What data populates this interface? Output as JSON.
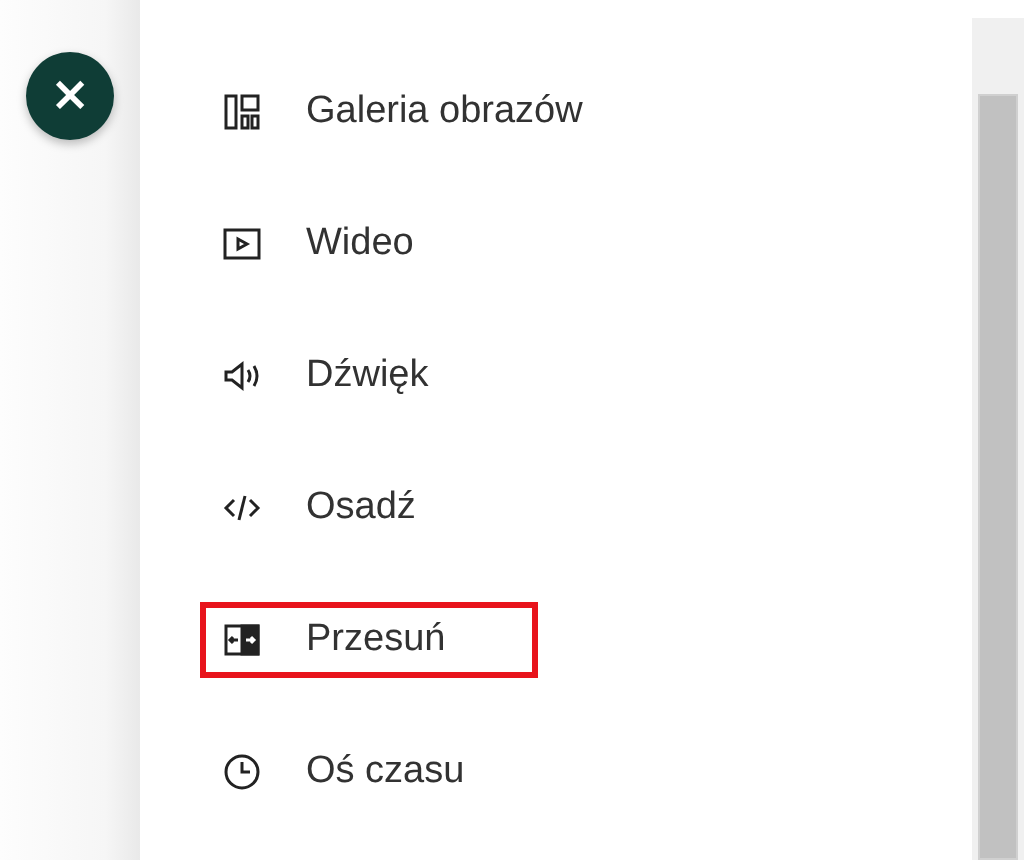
{
  "close_button": {
    "label": "×"
  },
  "menu": {
    "items": [
      {
        "kind": "gallery",
        "label": "Galeria obrazów",
        "highlighted": false
      },
      {
        "kind": "video",
        "label": "Wideo",
        "highlighted": false
      },
      {
        "kind": "audio",
        "label": "Dźwięk",
        "highlighted": false
      },
      {
        "kind": "embed",
        "label": "Osadź",
        "highlighted": false
      },
      {
        "kind": "swipe",
        "label": "Przesuń",
        "highlighted": true
      },
      {
        "kind": "timeline",
        "label": "Oś czasu",
        "highlighted": false
      }
    ]
  }
}
